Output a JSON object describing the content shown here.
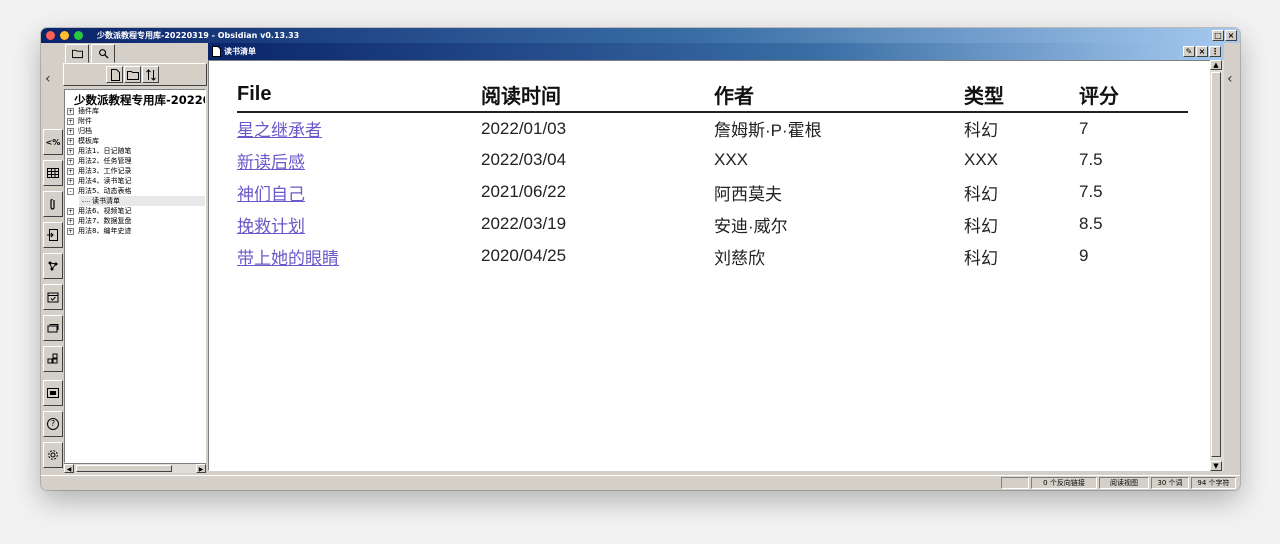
{
  "window": {
    "title": "少数派教程专用库-20220319 - Obsidian v0.13.33",
    "controls": [
      "restore",
      "close"
    ]
  },
  "ribbon": {
    "items": [
      {
        "icon": "code-icon",
        "label": "<%"
      },
      {
        "icon": "table-icon"
      },
      {
        "icon": "paperclip-icon"
      },
      {
        "icon": "import-icon"
      },
      {
        "icon": "graph-icon"
      },
      {
        "icon": "calendar-icon"
      },
      {
        "icon": "cards-icon"
      },
      {
        "icon": "blocks-icon"
      },
      {
        "icon": "slides-icon"
      },
      {
        "icon": "help-icon",
        "label": "?"
      },
      {
        "icon": "settings-icon"
      }
    ]
  },
  "sidebar": {
    "vault_name": "少数派教程专用库-20220",
    "tree": [
      {
        "label": "插件库",
        "state": "+"
      },
      {
        "label": "附件",
        "state": "+"
      },
      {
        "label": "归档",
        "state": "+"
      },
      {
        "label": "模板库",
        "state": "+"
      },
      {
        "label": "用法1、日记随笔",
        "state": "+"
      },
      {
        "label": "用法2、任务管理",
        "state": "+"
      },
      {
        "label": "用法3、工作记录",
        "state": "+"
      },
      {
        "label": "用法4、读书笔记",
        "state": "+"
      },
      {
        "label": "用法5、动态表格",
        "state": "-"
      },
      {
        "label": "读书清单",
        "child": true
      },
      {
        "label": "用法6、视频笔记",
        "state": "+"
      },
      {
        "label": "用法7、数据复盘",
        "state": "+"
      },
      {
        "label": "用法8、编年史迹",
        "state": "+"
      }
    ]
  },
  "pane": {
    "title": "读书清单"
  },
  "table": {
    "headers": [
      "File",
      "阅读时间",
      "作者",
      "类型",
      "评分"
    ],
    "rows": [
      {
        "file": "星之继承者",
        "date": "2022/01/03",
        "author": "詹姆斯·P·霍根",
        "type": "科幻",
        "score": "7"
      },
      {
        "file": "新读后感",
        "date": "2022/03/04",
        "author": "XXX",
        "type": "XXX",
        "score": "7.5"
      },
      {
        "file": "神们自己",
        "date": "2021/06/22",
        "author": "阿西莫夫",
        "type": "科幻",
        "score": "7.5"
      },
      {
        "file": "挽救计划",
        "date": "2022/03/19",
        "author": "安迪·威尔",
        "type": "科幻",
        "score": "8.5"
      },
      {
        "file": "带上她的眼睛",
        "date": "2020/04/25",
        "author": "刘慈欣",
        "type": "科幻",
        "score": "9"
      }
    ]
  },
  "status": {
    "backlinks": "0 个反向链接",
    "mode": "阅读视图",
    "words": "30 个词",
    "chars": "94 个字符"
  },
  "colors": {
    "link": "#6a59c8",
    "titlebar": "#0a246a",
    "chrome": "#d4d0c8"
  }
}
